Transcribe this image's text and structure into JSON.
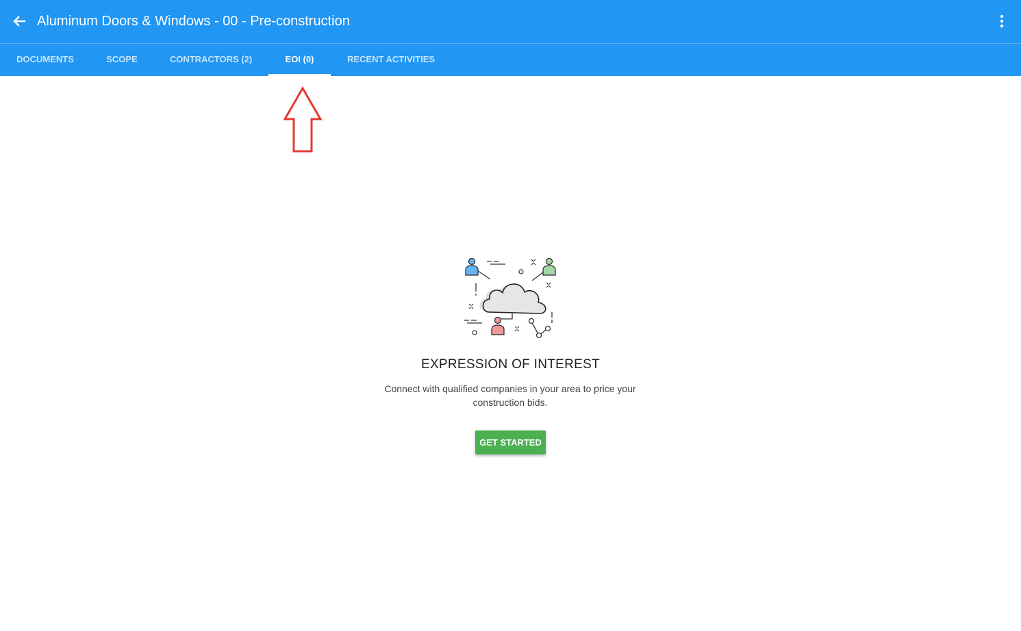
{
  "header": {
    "title": "Aluminum Doors & Windows - 00 - Pre-construction",
    "back_icon": "arrow-left-icon",
    "menu_icon": "more-vertical-icon",
    "background_color": "#2196f3"
  },
  "tabs": [
    {
      "label": "DOCUMENTS",
      "active": false
    },
    {
      "label": "SCOPE",
      "active": false
    },
    {
      "label": "CONTRACTORS (2)",
      "active": false
    },
    {
      "label": "EOI (0)",
      "active": true
    },
    {
      "label": "RECENT ACTIVITIES",
      "active": false
    }
  ],
  "annotation": {
    "icon": "arrow-up-outline-icon",
    "color": "#e53935"
  },
  "empty_state": {
    "illustration": "cloud-network-people-icon",
    "title": "EXPRESSION OF INTEREST",
    "description": "Connect with qualified companies in your area to price your construction bids.",
    "button_label": "GET STARTED",
    "button_color": "#4caf50"
  }
}
